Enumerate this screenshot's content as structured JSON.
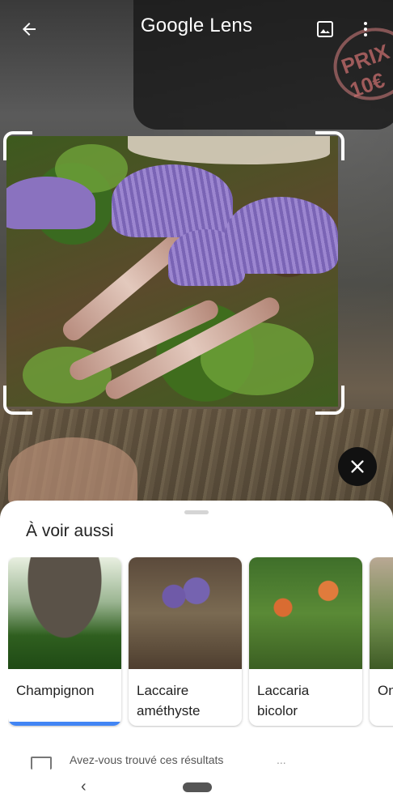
{
  "header": {
    "title": "Google Lens",
    "back_icon": "arrow-back-icon",
    "gallery_icon": "image-icon",
    "menu_icon": "more-vert-icon"
  },
  "background": {
    "stamp_text": "PRIX 10€"
  },
  "sheet": {
    "title": "À voir aussi",
    "cards": [
      {
        "label_line1": "Champignon",
        "label_line2": "",
        "selected": true
      },
      {
        "label_line1": "Laccaire",
        "label_line2": "améthyste",
        "selected": false
      },
      {
        "label_line1": "Laccaria",
        "label_line2": "bicolor",
        "selected": false
      },
      {
        "label_line1": "On",
        "label_line2": "",
        "selected": false
      }
    ],
    "feedback_text": "Avez-vous trouvé ces résultats",
    "feedback_right": "..."
  },
  "colors": {
    "accent": "#4285f4",
    "sheet_bg": "#ffffff",
    "close_bg": "#111111"
  }
}
